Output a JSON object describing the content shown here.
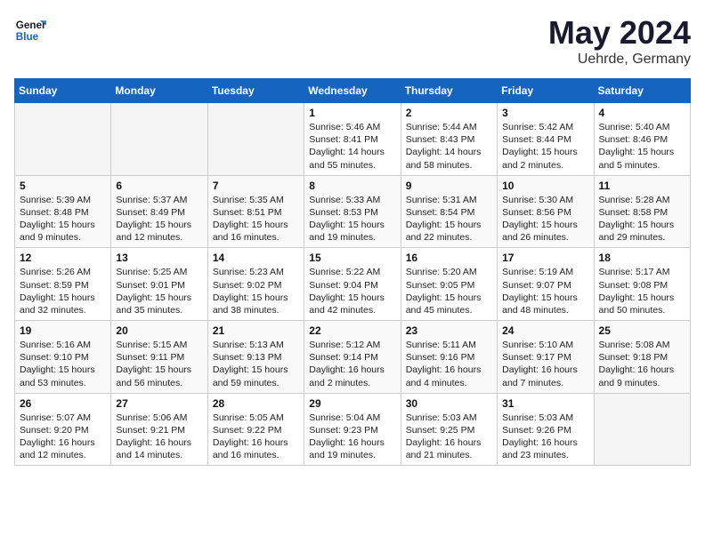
{
  "logo": {
    "text_general": "General",
    "text_blue": "Blue"
  },
  "title": {
    "month_year": "May 2024",
    "location": "Uehrde, Germany"
  },
  "weekdays": [
    "Sunday",
    "Monday",
    "Tuesday",
    "Wednesday",
    "Thursday",
    "Friday",
    "Saturday"
  ],
  "weeks": [
    [
      {
        "day": "",
        "info": ""
      },
      {
        "day": "",
        "info": ""
      },
      {
        "day": "",
        "info": ""
      },
      {
        "day": "1",
        "info": "Sunrise: 5:46 AM\nSunset: 8:41 PM\nDaylight: 14 hours\nand 55 minutes."
      },
      {
        "day": "2",
        "info": "Sunrise: 5:44 AM\nSunset: 8:43 PM\nDaylight: 14 hours\nand 58 minutes."
      },
      {
        "day": "3",
        "info": "Sunrise: 5:42 AM\nSunset: 8:44 PM\nDaylight: 15 hours\nand 2 minutes."
      },
      {
        "day": "4",
        "info": "Sunrise: 5:40 AM\nSunset: 8:46 PM\nDaylight: 15 hours\nand 5 minutes."
      }
    ],
    [
      {
        "day": "5",
        "info": "Sunrise: 5:39 AM\nSunset: 8:48 PM\nDaylight: 15 hours\nand 9 minutes."
      },
      {
        "day": "6",
        "info": "Sunrise: 5:37 AM\nSunset: 8:49 PM\nDaylight: 15 hours\nand 12 minutes."
      },
      {
        "day": "7",
        "info": "Sunrise: 5:35 AM\nSunset: 8:51 PM\nDaylight: 15 hours\nand 16 minutes."
      },
      {
        "day": "8",
        "info": "Sunrise: 5:33 AM\nSunset: 8:53 PM\nDaylight: 15 hours\nand 19 minutes."
      },
      {
        "day": "9",
        "info": "Sunrise: 5:31 AM\nSunset: 8:54 PM\nDaylight: 15 hours\nand 22 minutes."
      },
      {
        "day": "10",
        "info": "Sunrise: 5:30 AM\nSunset: 8:56 PM\nDaylight: 15 hours\nand 26 minutes."
      },
      {
        "day": "11",
        "info": "Sunrise: 5:28 AM\nSunset: 8:58 PM\nDaylight: 15 hours\nand 29 minutes."
      }
    ],
    [
      {
        "day": "12",
        "info": "Sunrise: 5:26 AM\nSunset: 8:59 PM\nDaylight: 15 hours\nand 32 minutes."
      },
      {
        "day": "13",
        "info": "Sunrise: 5:25 AM\nSunset: 9:01 PM\nDaylight: 15 hours\nand 35 minutes."
      },
      {
        "day": "14",
        "info": "Sunrise: 5:23 AM\nSunset: 9:02 PM\nDaylight: 15 hours\nand 38 minutes."
      },
      {
        "day": "15",
        "info": "Sunrise: 5:22 AM\nSunset: 9:04 PM\nDaylight: 15 hours\nand 42 minutes."
      },
      {
        "day": "16",
        "info": "Sunrise: 5:20 AM\nSunset: 9:05 PM\nDaylight: 15 hours\nand 45 minutes."
      },
      {
        "day": "17",
        "info": "Sunrise: 5:19 AM\nSunset: 9:07 PM\nDaylight: 15 hours\nand 48 minutes."
      },
      {
        "day": "18",
        "info": "Sunrise: 5:17 AM\nSunset: 9:08 PM\nDaylight: 15 hours\nand 50 minutes."
      }
    ],
    [
      {
        "day": "19",
        "info": "Sunrise: 5:16 AM\nSunset: 9:10 PM\nDaylight: 15 hours\nand 53 minutes."
      },
      {
        "day": "20",
        "info": "Sunrise: 5:15 AM\nSunset: 9:11 PM\nDaylight: 15 hours\nand 56 minutes."
      },
      {
        "day": "21",
        "info": "Sunrise: 5:13 AM\nSunset: 9:13 PM\nDaylight: 15 hours\nand 59 minutes."
      },
      {
        "day": "22",
        "info": "Sunrise: 5:12 AM\nSunset: 9:14 PM\nDaylight: 16 hours\nand 2 minutes."
      },
      {
        "day": "23",
        "info": "Sunrise: 5:11 AM\nSunset: 9:16 PM\nDaylight: 16 hours\nand 4 minutes."
      },
      {
        "day": "24",
        "info": "Sunrise: 5:10 AM\nSunset: 9:17 PM\nDaylight: 16 hours\nand 7 minutes."
      },
      {
        "day": "25",
        "info": "Sunrise: 5:08 AM\nSunset: 9:18 PM\nDaylight: 16 hours\nand 9 minutes."
      }
    ],
    [
      {
        "day": "26",
        "info": "Sunrise: 5:07 AM\nSunset: 9:20 PM\nDaylight: 16 hours\nand 12 minutes."
      },
      {
        "day": "27",
        "info": "Sunrise: 5:06 AM\nSunset: 9:21 PM\nDaylight: 16 hours\nand 14 minutes."
      },
      {
        "day": "28",
        "info": "Sunrise: 5:05 AM\nSunset: 9:22 PM\nDaylight: 16 hours\nand 16 minutes."
      },
      {
        "day": "29",
        "info": "Sunrise: 5:04 AM\nSunset: 9:23 PM\nDaylight: 16 hours\nand 19 minutes."
      },
      {
        "day": "30",
        "info": "Sunrise: 5:03 AM\nSunset: 9:25 PM\nDaylight: 16 hours\nand 21 minutes."
      },
      {
        "day": "31",
        "info": "Sunrise: 5:03 AM\nSunset: 9:26 PM\nDaylight: 16 hours\nand 23 minutes."
      },
      {
        "day": "",
        "info": ""
      }
    ]
  ]
}
